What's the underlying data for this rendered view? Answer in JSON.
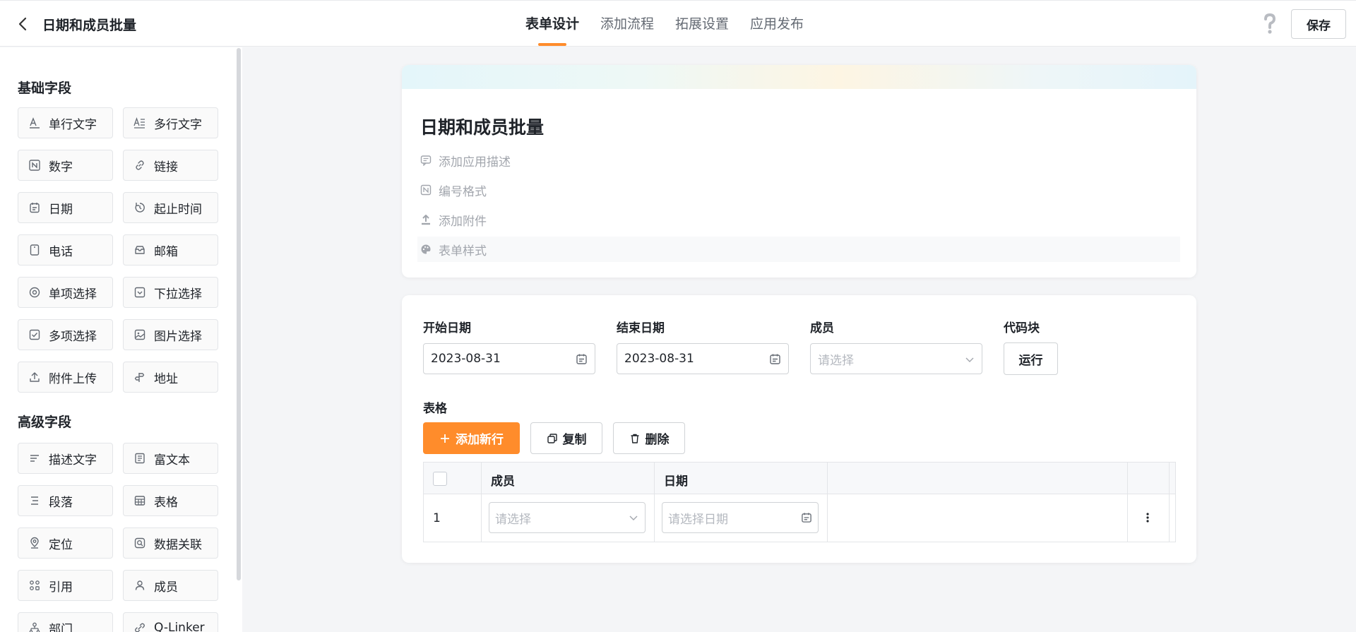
{
  "header": {
    "title": "日期和成员批量",
    "tabs": [
      {
        "label": "表单设计",
        "active": true
      },
      {
        "label": "添加流程",
        "active": false
      },
      {
        "label": "拓展设置",
        "active": false
      },
      {
        "label": "应用发布",
        "active": false
      }
    ],
    "save_label": "保存",
    "help_icon": "question-mark-icon",
    "accent_color": "#ff8c2b"
  },
  "sidebar": {
    "basic_title": "基础字段",
    "basic_fields": [
      {
        "label": "单行文字",
        "icon": "single-line-text-icon"
      },
      {
        "label": "多行文字",
        "icon": "multi-line-text-icon"
      },
      {
        "label": "数字",
        "icon": "number-icon"
      },
      {
        "label": "链接",
        "icon": "link-icon"
      },
      {
        "label": "日期",
        "icon": "calendar-icon"
      },
      {
        "label": "起止时间",
        "icon": "time-range-icon"
      },
      {
        "label": "电话",
        "icon": "phone-icon"
      },
      {
        "label": "邮箱",
        "icon": "mail-icon"
      },
      {
        "label": "单项选择",
        "icon": "radio-icon"
      },
      {
        "label": "下拉选择",
        "icon": "dropdown-icon"
      },
      {
        "label": "多项选择",
        "icon": "checkbox-icon"
      },
      {
        "label": "图片选择",
        "icon": "image-icon"
      },
      {
        "label": "附件上传",
        "icon": "upload-icon"
      },
      {
        "label": "地址",
        "icon": "address-icon"
      }
    ],
    "advanced_title": "高级字段",
    "advanced_fields": [
      {
        "label": "描述文字",
        "icon": "description-icon"
      },
      {
        "label": "富文本",
        "icon": "rich-text-icon"
      },
      {
        "label": "段落",
        "icon": "paragraph-icon"
      },
      {
        "label": "表格",
        "icon": "table-icon"
      },
      {
        "label": "定位",
        "icon": "location-icon"
      },
      {
        "label": "数据关联",
        "icon": "data-link-icon"
      },
      {
        "label": "引用",
        "icon": "reference-icon"
      },
      {
        "label": "成员",
        "icon": "member-icon"
      },
      {
        "label": "部门",
        "icon": "department-icon"
      },
      {
        "label": "Q-Linker",
        "icon": "q-linker-icon"
      }
    ]
  },
  "form_header": {
    "title": "日期和成员批量",
    "meta_items": [
      {
        "label": "添加应用描述",
        "icon": "comment-icon"
      },
      {
        "label": "编号格式",
        "icon": "number-format-icon"
      },
      {
        "label": "添加附件",
        "icon": "attachment-upload-icon"
      },
      {
        "label": "表单样式",
        "icon": "palette-icon"
      }
    ]
  },
  "form_fields": {
    "start_date": {
      "label": "开始日期",
      "value": "2023-08-31"
    },
    "end_date": {
      "label": "结束日期",
      "value": "2023-08-31"
    },
    "member": {
      "label": "成员",
      "placeholder": "请选择"
    },
    "code_block": {
      "label": "代码块",
      "button": "运行"
    }
  },
  "table": {
    "label": "表格",
    "add_row": "添加新行",
    "copy": "复制",
    "delete": "删除",
    "columns": [
      "成员",
      "日期"
    ],
    "rows": [
      {
        "index": "1",
        "member_placeholder": "请选择",
        "date_placeholder": "请选择日期"
      }
    ]
  }
}
